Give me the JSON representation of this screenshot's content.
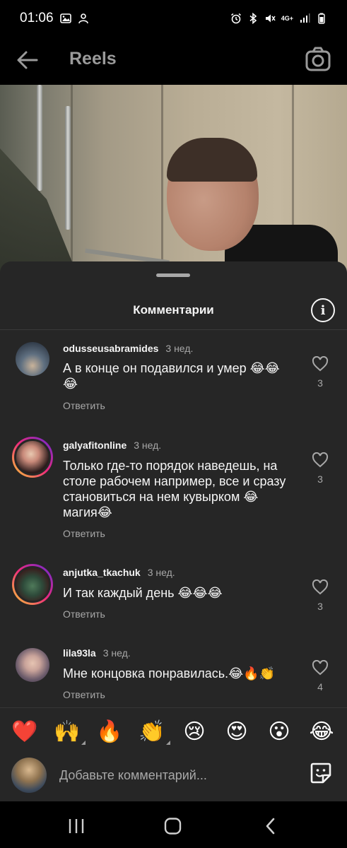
{
  "status_bar": {
    "time": "01:06",
    "network": "4G+"
  },
  "top_bar": {
    "title": "Reels"
  },
  "comments_sheet": {
    "title": "Комментарии",
    "reply_label": "Ответить",
    "comments": [
      {
        "username": "odusseusabramides",
        "time": "3 нед.",
        "text": "А в конце он подавился и умер 😂😂😂",
        "likes": "3"
      },
      {
        "username": "galyafitonline",
        "time": "3 нед.",
        "text": "Только где-то порядок наведешь, на столе рабочем например, все и сразу становиться на нем кувырком 😂 магия😂",
        "likes": "3"
      },
      {
        "username": "anjutka_tkachuk",
        "time": "3 нед.",
        "text": "И так каждый день 😂😂😂",
        "likes": "3"
      },
      {
        "username": "lila93la",
        "time": "3 нед.",
        "text": "Мне концовка понравилась.😂🔥👏",
        "likes": "4"
      }
    ]
  },
  "emoji_bar": {
    "emojis": [
      "❤️",
      "🙌",
      "🔥",
      "👏",
      "😢",
      "😍",
      "😮",
      "😂"
    ]
  },
  "comment_input": {
    "placeholder": "Добавьте комментарий..."
  },
  "colors": {
    "sheet_bg": "#262626",
    "text_primary": "#f5f5f5",
    "text_secondary": "#a8a8a8",
    "heart_red": "#ff3040"
  }
}
